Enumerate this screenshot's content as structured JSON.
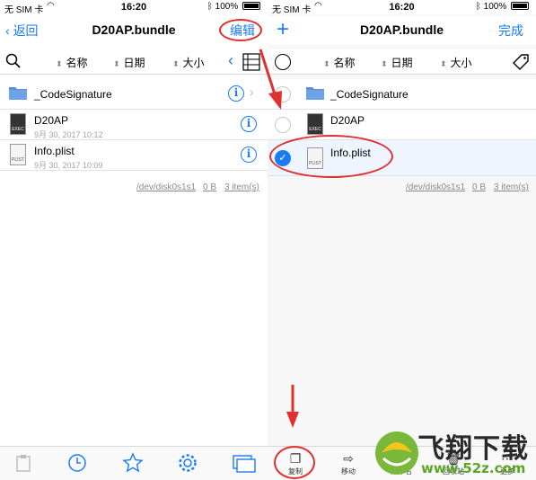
{
  "left": {
    "status": {
      "carrier": "无 SIM 卡",
      "time": "16:20",
      "battery": "100%"
    },
    "nav": {
      "back": "返回",
      "title": "D20AP.bundle",
      "edit": "编辑"
    },
    "sort": {
      "name": "名称",
      "date": "日期",
      "size": "大小"
    },
    "rows": [
      {
        "name": "_CodeSignature"
      },
      {
        "name": "D20AP",
        "date": "9月 30, 2017 10:12"
      },
      {
        "name": "Info.plist",
        "date": "9月 30, 2017 10:09"
      }
    ],
    "footer": {
      "path": "/dev/disk0s1s1",
      "size": "0 B",
      "count": "3 item(s)"
    }
  },
  "right": {
    "status": {
      "carrier": "无 SIM 卡",
      "time": "16:20",
      "battery": "100%"
    },
    "nav": {
      "title": "D20AP.bundle",
      "done": "完成"
    },
    "sort": {
      "name": "名称",
      "date": "日期",
      "size": "大小"
    },
    "rows": [
      {
        "name": "_CodeSignature"
      },
      {
        "name": "D20AP"
      },
      {
        "name": "Info.plist"
      }
    ],
    "footer": {
      "path": "/dev/disk0s1s1",
      "size": "0 B",
      "count": "3 item(s)"
    },
    "tabs": {
      "copy": "复制",
      "move": "移动",
      "rename": "重命名",
      "trash": "回收站",
      "more": "更多"
    }
  },
  "icons": {
    "exec": "EXEC",
    "plist": "PLIST"
  },
  "watermark": {
    "brand": "飞翔下载",
    "site": "www.52z.com"
  },
  "colors": {
    "accent": "#1a7cf5",
    "annotation": "#e03030",
    "brand_green": "#5aa728"
  }
}
